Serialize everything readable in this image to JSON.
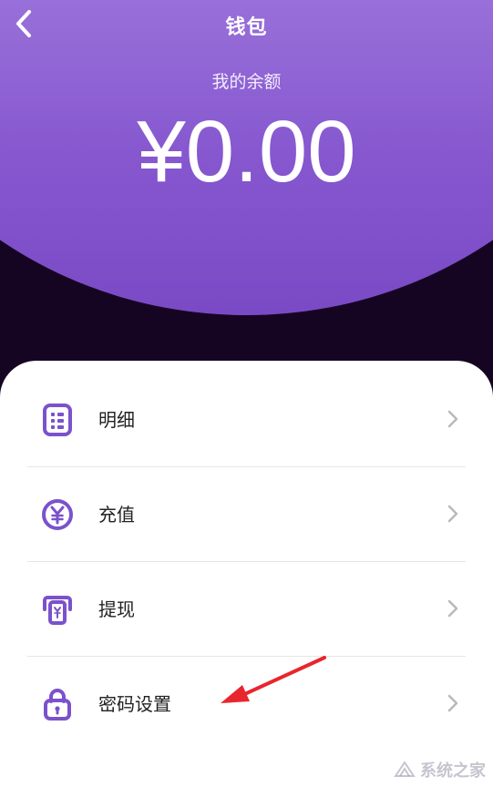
{
  "header": {
    "title": "钱包",
    "back_icon": "chevron-left-icon"
  },
  "balance": {
    "label": "我的余额",
    "amount": "¥0.00"
  },
  "menu": {
    "items": [
      {
        "label": "明细",
        "icon": "details-list-icon"
      },
      {
        "label": "充值",
        "icon": "yuan-coin-icon"
      },
      {
        "label": "提现",
        "icon": "withdraw-atm-icon"
      },
      {
        "label": "密码设置",
        "icon": "lock-icon"
      }
    ]
  },
  "colors": {
    "header_top": "#b592e6",
    "header_bottom": "#7a4ac6",
    "icon_purple": "#7b52cc",
    "dark_band": "#160522",
    "annotation_red": "#e8262d"
  },
  "watermark": {
    "text": "系统之家"
  }
}
